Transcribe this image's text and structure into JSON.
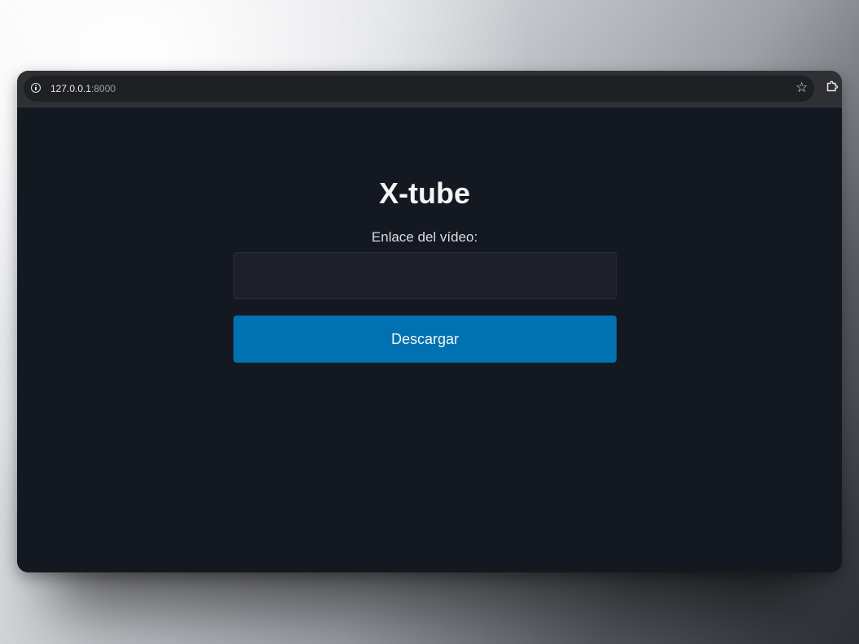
{
  "browser": {
    "url_host": "127.0.0.1",
    "url_port": ":8000",
    "icons": {
      "site_info": "info-circle-icon",
      "bookmark": "star-icon",
      "extensions": "puzzle-piece-icon"
    }
  },
  "page": {
    "title": "X-tube",
    "video_link_label": "Enlace del vídeo:",
    "video_link_value": "",
    "download_button_label": "Descargar"
  },
  "colors": {
    "page_background": "#141820",
    "input_background": "#1d2029",
    "button_accent": "#0172b1",
    "text_primary": "#f4f4f4"
  }
}
